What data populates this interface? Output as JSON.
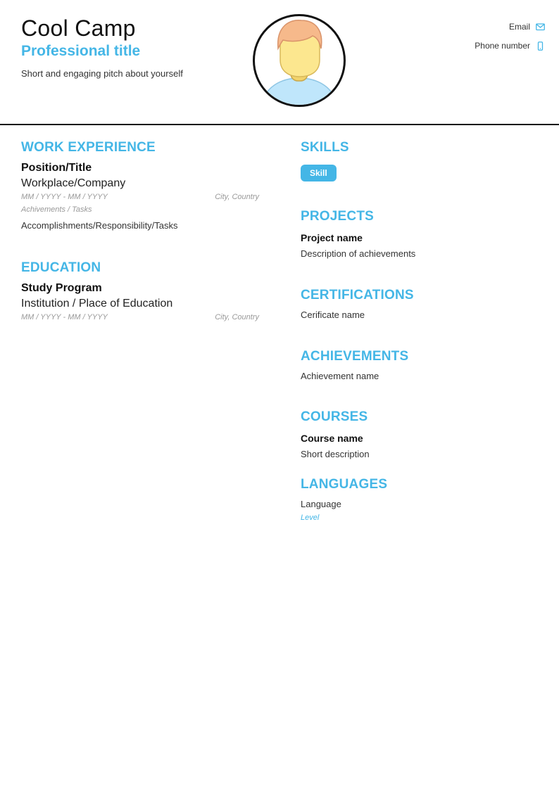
{
  "header": {
    "name": "Cool Camp",
    "professional_title": "Professional title",
    "pitch": "Short and engaging pitch about yourself",
    "contacts": {
      "email_label": "Email",
      "email_icon": "envelope-icon",
      "phone_label": "Phone number",
      "phone_icon": "mobile-phone-icon"
    },
    "avatar_icon": "person-avatar-icon"
  },
  "colors": {
    "accent": "#44b6e6",
    "text": "#222222",
    "muted": "#999999",
    "rule": "#111111"
  },
  "work_experience": {
    "title": "WORK EXPERIENCE",
    "items": [
      {
        "position": "Position/Title",
        "company": "Workplace/Company",
        "dates": "MM  /  YYYY  -  MM  /  YYYY",
        "location": "City, Country",
        "achievements_label": "Achivements / Tasks",
        "achievements": "Accomplishments/Responsibility/Tasks"
      }
    ]
  },
  "education": {
    "title": "EDUCATION",
    "items": [
      {
        "program": "Study Program",
        "institution": "Institution / Place of Education",
        "dates": "MM  /  YYYY  -  MM  /  YYYY",
        "location": "City, Country"
      }
    ]
  },
  "skills": {
    "title": "SKILLS",
    "items": [
      "Skill"
    ]
  },
  "projects": {
    "title": "PROJECTS",
    "items": [
      {
        "name": "Project name",
        "description": "Description of achievements"
      }
    ]
  },
  "certifications": {
    "title": "CERTIFICATIONS",
    "items": [
      "Cerificate name"
    ]
  },
  "achievements": {
    "title": "ACHIEVEMENTS",
    "items": [
      "Achievement name"
    ]
  },
  "courses": {
    "title": "COURSES",
    "items": [
      {
        "name": "Course name",
        "description": "Short description"
      }
    ]
  },
  "languages": {
    "title": "LANGUAGES",
    "items": [
      {
        "language": "Language",
        "level": "Level"
      }
    ]
  }
}
